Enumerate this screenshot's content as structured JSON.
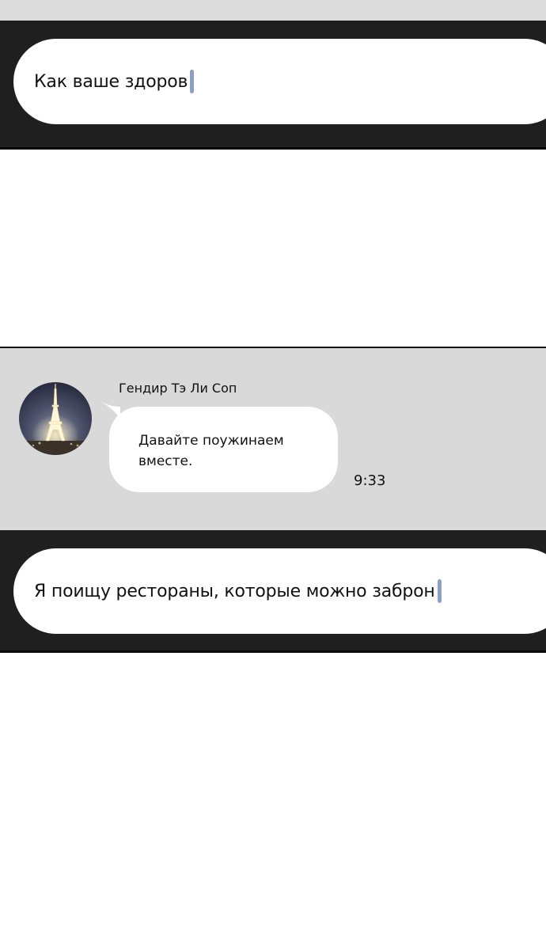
{
  "panels": [
    {
      "input_text": "Как ваше здоров"
    },
    {
      "input_text": "Я поищу рестораны, которые можно заброн"
    }
  ],
  "chat": {
    "sender_name": "Гендир Тэ Ли Соп",
    "message": "Давайте поужинаем вместе.",
    "time": "9:33",
    "avatar_icon": "eiffel-tower-photo"
  },
  "colors": {
    "panel_dark": "#1f1f1f",
    "chat_bg": "#d9d9d9",
    "bubble": "#ffffff",
    "caret": "#8d9fc4"
  }
}
